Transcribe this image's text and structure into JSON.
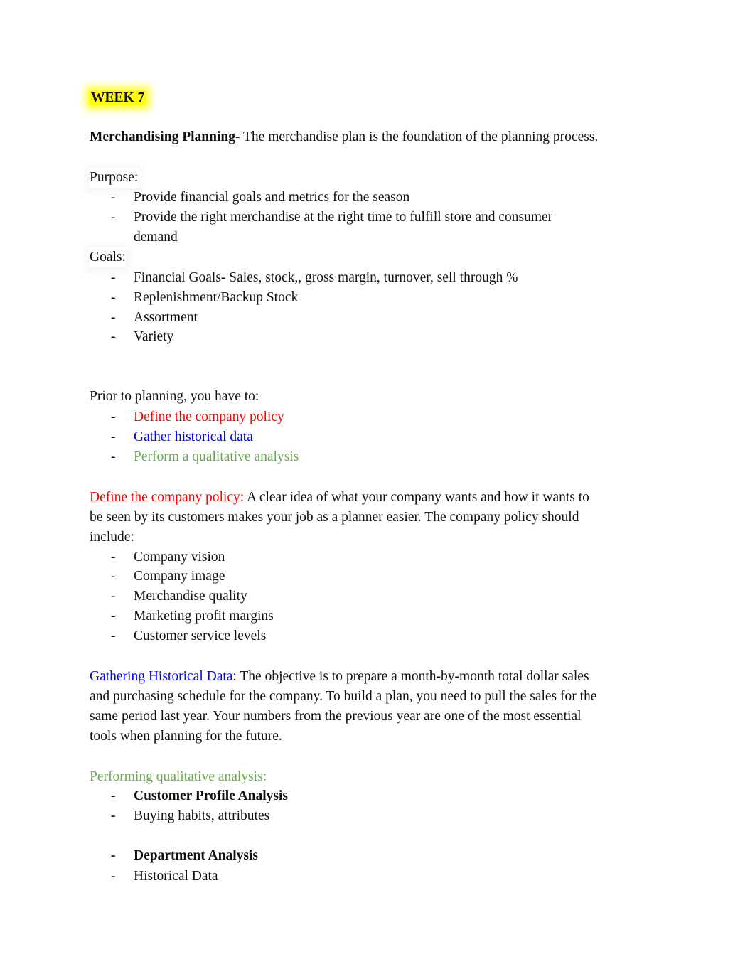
{
  "colors": {
    "highlight": "#ffff00",
    "red": "#ff0000",
    "blue": "#0000ff",
    "green": "#6aa84f",
    "text": "#111111"
  },
  "week_label": "WEEK 7",
  "intro": {
    "term": "Merchandising Planning-",
    "text": " The merchandise plan is the foundation of the planning process."
  },
  "purpose": {
    "heading": "Purpose:",
    "items": [
      "Provide financial goals and metrics for the season",
      "Provide the right merchandise at the right time to fulfill store and consumer",
      "demand"
    ]
  },
  "goals": {
    "heading": "Goals:",
    "items": [
      "Financial Goals- Sales, stock,, gross margin, turnover, sell through %",
      "Replenishment/Backup Stock",
      "Assortment",
      "Variety"
    ]
  },
  "prior": {
    "heading": "Prior to planning, you have to:",
    "items": [
      "Define the company policy",
      "Gather historical data",
      "Perform a qualitative analysis"
    ]
  },
  "policy": {
    "term": "Define the company policy:",
    "lines": [
      " A clear idea of what your company wants and how it wants to",
      "be seen by its customers makes your job as a planner easier. The company policy should",
      "include:"
    ],
    "items": [
      "Company vision",
      "Company image",
      "Merchandise quality",
      "Marketing profit margins",
      "Customer service levels"
    ]
  },
  "historical": {
    "term": "Gathering Historical Data:",
    "lines": [
      " The objective is to prepare a month-by-month total dollar sales",
      "and purchasing schedule for the company. To build a plan, you need to pull the sales for the",
      "same period last year. Your numbers from the previous year are one of the most essential",
      "tools when planning for the future."
    ]
  },
  "qualitative": {
    "heading": "Performing qualitative analysis:",
    "items": [
      {
        "text": "Customer Profile Analysis",
        "bold": true
      },
      {
        "text": "Buying habits, attributes",
        "bold": false
      },
      {
        "text": "Department Analysis",
        "bold": true
      },
      {
        "text": "Historical Data",
        "bold": false
      }
    ]
  },
  "bullet_glyph": "-"
}
